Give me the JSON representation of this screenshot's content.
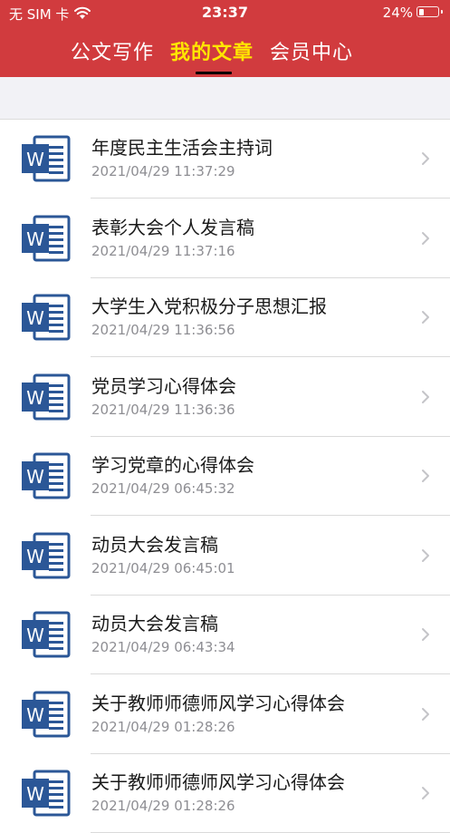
{
  "status_bar": {
    "carrier": "无 SIM 卡",
    "time": "23:37",
    "battery": "24%",
    "battery_level": 0.24
  },
  "tabs": [
    {
      "label": "公文写作",
      "active": false
    },
    {
      "label": "我的文章",
      "active": true
    },
    {
      "label": "会员中心",
      "active": false
    }
  ],
  "colors": {
    "header_bg": "#d13b3e",
    "active_tab": "#ffe600",
    "word_icon_blue": "#2b5797"
  },
  "articles": [
    {
      "icon": "word-doc-icon",
      "title": "年度民主生活会主持词",
      "date": "2021/04/29 11:37:29"
    },
    {
      "icon": "word-doc-icon",
      "title": "表彰大会个人发言稿",
      "date": "2021/04/29 11:37:16"
    },
    {
      "icon": "word-doc-icon",
      "title": "大学生入党积极分子思想汇报",
      "date": "2021/04/29 11:36:56"
    },
    {
      "icon": "word-doc-icon",
      "title": "党员学习心得体会",
      "date": "2021/04/29 11:36:36"
    },
    {
      "icon": "word-doc-icon",
      "title": "学习党章的心得体会",
      "date": "2021/04/29 06:45:32"
    },
    {
      "icon": "word-doc-icon",
      "title": "动员大会发言稿",
      "date": "2021/04/29 06:45:01"
    },
    {
      "icon": "word-doc-icon",
      "title": "动员大会发言稿",
      "date": "2021/04/29 06:43:34"
    },
    {
      "icon": "word-doc-icon",
      "title": "关于教师师德师风学习心得体会",
      "date": "2021/04/29 01:28:26"
    },
    {
      "icon": "word-doc-icon",
      "title": "关于教师师德师风学习心得体会",
      "date": "2021/04/29 01:28:26"
    }
  ]
}
